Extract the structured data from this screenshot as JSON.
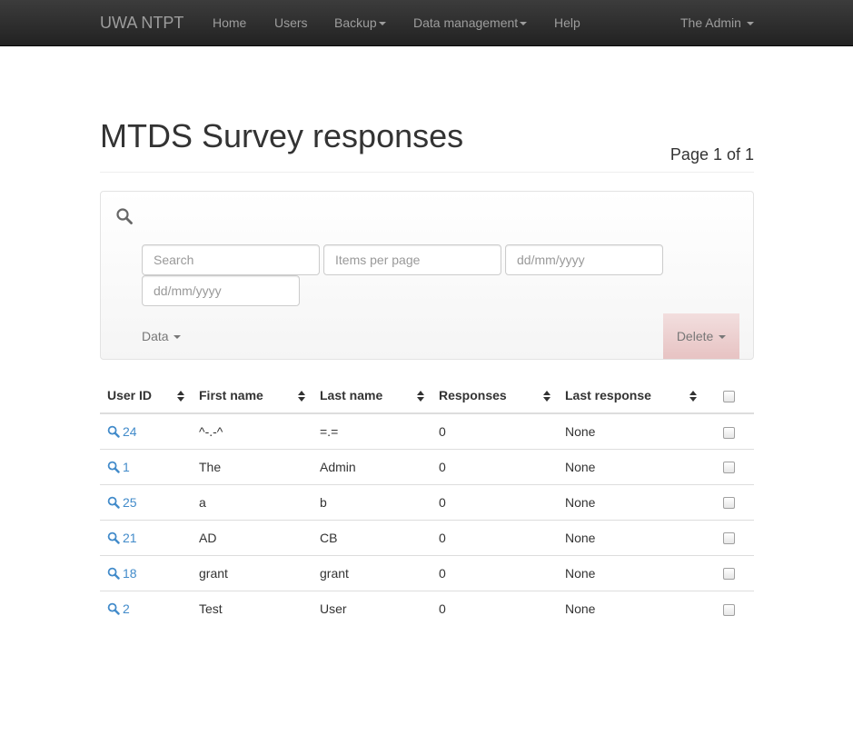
{
  "nav": {
    "brand": "UWA NTPT",
    "items": [
      {
        "label": "Home",
        "dropdown": false
      },
      {
        "label": "Users",
        "dropdown": false
      },
      {
        "label": "Backup",
        "dropdown": true
      },
      {
        "label": "Data management",
        "dropdown": true
      },
      {
        "label": "Help",
        "dropdown": false
      }
    ],
    "user_menu": "The Admin"
  },
  "page": {
    "title": "MTDS Survey responses",
    "page_info": "Page 1 of 1"
  },
  "filters": {
    "search_placeholder": "Search",
    "items_per_page_placeholder": "Items per page",
    "date_from_placeholder": "dd/mm/yyyy",
    "date_to_placeholder": "dd/mm/yyyy",
    "data_menu_label": "Data",
    "delete_menu_label": "Delete"
  },
  "table": {
    "headers": [
      "User ID",
      "First name",
      "Last name",
      "Responses",
      "Last response"
    ],
    "rows": [
      {
        "user_id": "24",
        "first_name": "^-.-^",
        "last_name": "=.=",
        "responses": "0",
        "last_response": "None"
      },
      {
        "user_id": "1",
        "first_name": "The",
        "last_name": "Admin",
        "responses": "0",
        "last_response": "None"
      },
      {
        "user_id": "25",
        "first_name": "a",
        "last_name": "b",
        "responses": "0",
        "last_response": "None"
      },
      {
        "user_id": "21",
        "first_name": "AD",
        "last_name": "CB",
        "responses": "0",
        "last_response": "None"
      },
      {
        "user_id": "18",
        "first_name": "grant",
        "last_name": "grant",
        "responses": "0",
        "last_response": "None"
      },
      {
        "user_id": "2",
        "first_name": "Test",
        "last_name": "User",
        "responses": "0",
        "last_response": "None"
      }
    ]
  },
  "colors": {
    "link": "#428bca",
    "navbar_text": "#9d9d9d",
    "delete_bg": "#f2dede"
  },
  "icons": {
    "search": "search-icon",
    "sort": "sort-icon",
    "caret": "caret-down-icon"
  }
}
